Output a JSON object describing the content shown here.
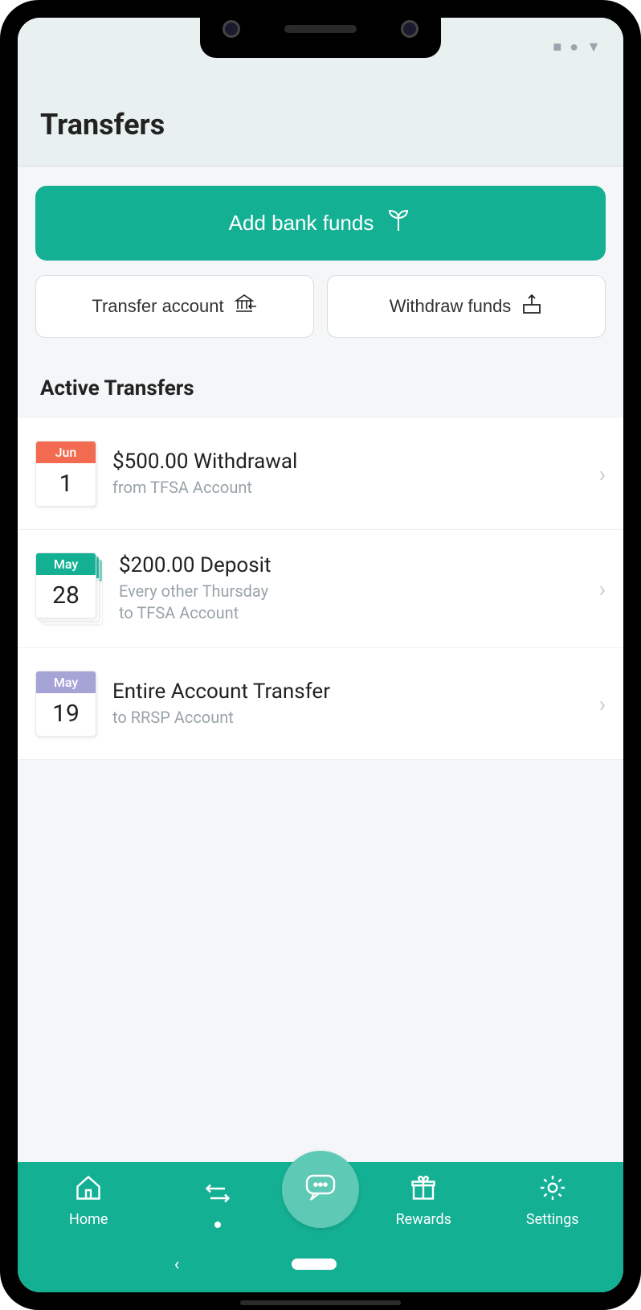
{
  "header": {
    "title": "Transfers"
  },
  "actions": {
    "add_funds_label": "Add bank funds",
    "transfer_account_label": "Transfer account",
    "withdraw_label": "Withdraw funds"
  },
  "section": {
    "active_title": "Active Transfers"
  },
  "transfers": [
    {
      "month": "Jun",
      "day": "1",
      "color": "red",
      "stack": false,
      "title": "$500.00 Withdrawal",
      "line1": "from TFSA Account",
      "line2": ""
    },
    {
      "month": "May",
      "day": "28",
      "color": "green",
      "stack": true,
      "title": "$200.00 Deposit",
      "line1": "Every other Thursday",
      "line2": "to TFSA Account"
    },
    {
      "month": "May",
      "day": "19",
      "color": "purple",
      "stack": false,
      "title": "Entire Account Transfer",
      "line1": "to RRSP Account",
      "line2": ""
    }
  ],
  "tabs": {
    "home": "Home",
    "transfers": "",
    "rewards": "Rewards",
    "settings": "Settings"
  },
  "colors": {
    "accent": "#14b094",
    "red": "#f26a50",
    "purple": "#a6a4d6"
  }
}
